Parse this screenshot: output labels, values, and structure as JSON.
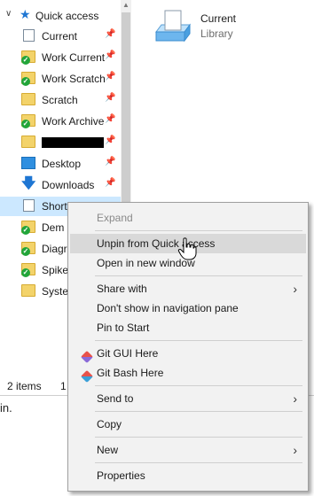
{
  "nav": {
    "quick_access_label": "Quick access",
    "items": [
      {
        "label": "Current",
        "icon": "library-icon",
        "pinned": true
      },
      {
        "label": "Work Current",
        "icon": "folder-sync-icon",
        "pinned": true
      },
      {
        "label": "Work Scratch",
        "icon": "folder-sync-icon",
        "pinned": true
      },
      {
        "label": "Scratch",
        "icon": "folder-icon",
        "pinned": true
      },
      {
        "label": "Work Archive",
        "icon": "folder-sync-icon",
        "pinned": true
      },
      {
        "label": "",
        "icon": "folder-icon",
        "pinned": true,
        "redacted": true
      },
      {
        "label": "Desktop",
        "icon": "desktop-icon",
        "pinned": true
      },
      {
        "label": "Downloads",
        "icon": "downloads-icon",
        "pinned": true
      },
      {
        "label": "Short",
        "icon": "library-icon",
        "pinned": false,
        "selected": true
      },
      {
        "label": "Dem",
        "icon": "folder-sync-icon",
        "pinned": false
      },
      {
        "label": "Diagr",
        "icon": "folder-sync-icon",
        "pinned": false
      },
      {
        "label": "Spike",
        "icon": "folder-sync-icon",
        "pinned": false
      },
      {
        "label": "Syste",
        "icon": "folder-icon",
        "pinned": false
      }
    ]
  },
  "content": {
    "item_name": "Current",
    "item_type": "Library"
  },
  "status": {
    "items": "2 items",
    "selected": "1"
  },
  "below_text": "in.",
  "context_menu": {
    "expand": "Expand",
    "unpin": "Unpin from Quick access",
    "open_new_window": "Open in new window",
    "share_with": "Share with",
    "dont_show": "Don't show in navigation pane",
    "pin_start": "Pin to Start",
    "git_gui": "Git GUI Here",
    "git_bash": "Git Bash Here",
    "send_to": "Send to",
    "copy": "Copy",
    "new": "New",
    "properties": "Properties"
  },
  "colors": {
    "accent": "#1e76d3",
    "selection": "#cce8ff",
    "menu_bg": "#f2f2f2",
    "menu_hover": "#d9d9d9"
  }
}
